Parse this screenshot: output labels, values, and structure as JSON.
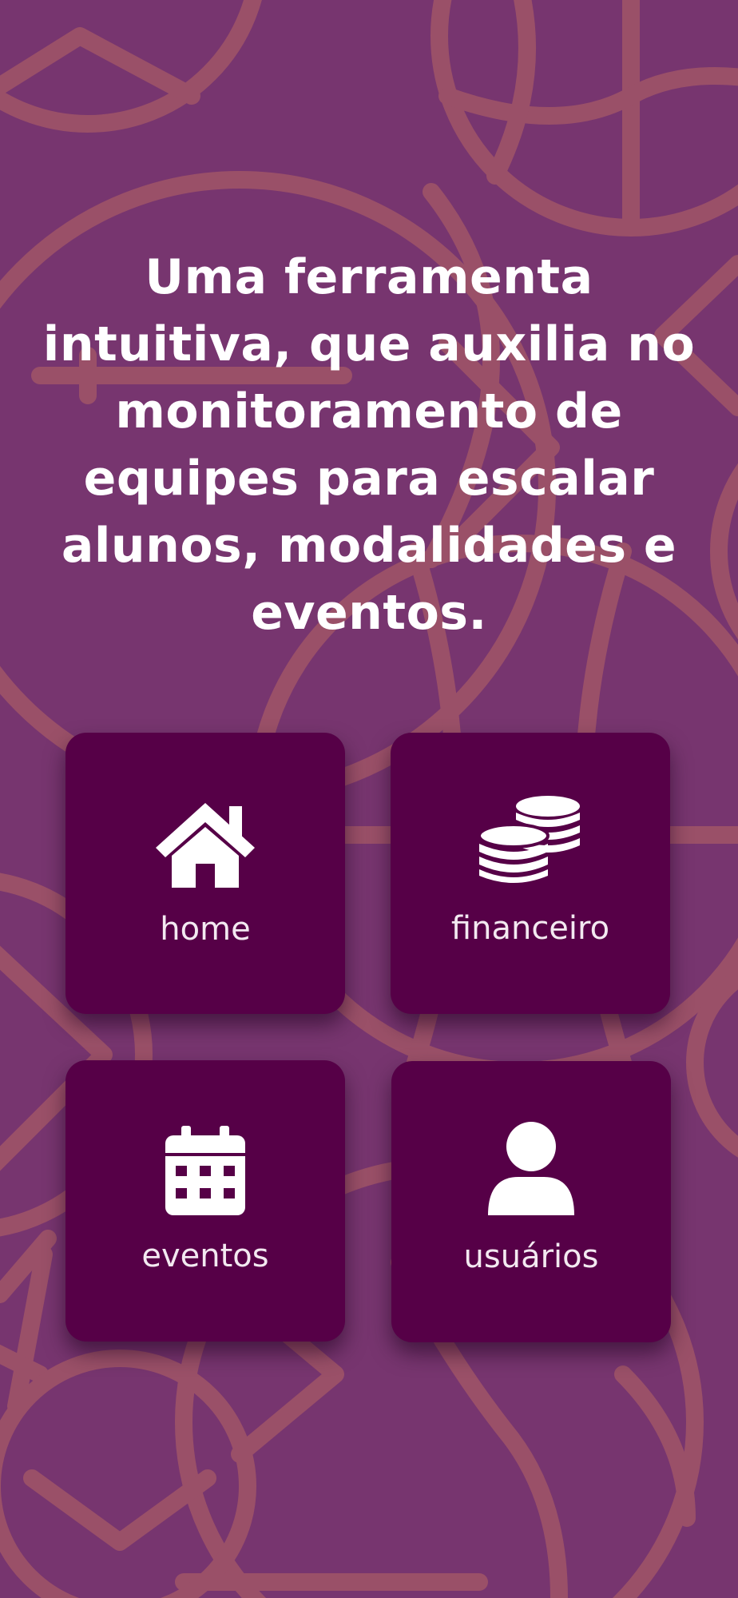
{
  "headline": "Uma ferramenta intuitiva, que auxilia no monitoramento de equipes para escalar alunos, modalidades e eventos.",
  "menu": [
    {
      "label": "home",
      "icon": "house-icon"
    },
    {
      "label": "financeiro",
      "icon": "coins-icon"
    },
    {
      "label": "eventos",
      "icon": "calendar-icon"
    },
    {
      "label": "usuários",
      "icon": "user-icon"
    }
  ],
  "colors": {
    "background": "#77356f",
    "pattern": "#9a5068",
    "tile": "#560047",
    "text": "#ffffff"
  }
}
